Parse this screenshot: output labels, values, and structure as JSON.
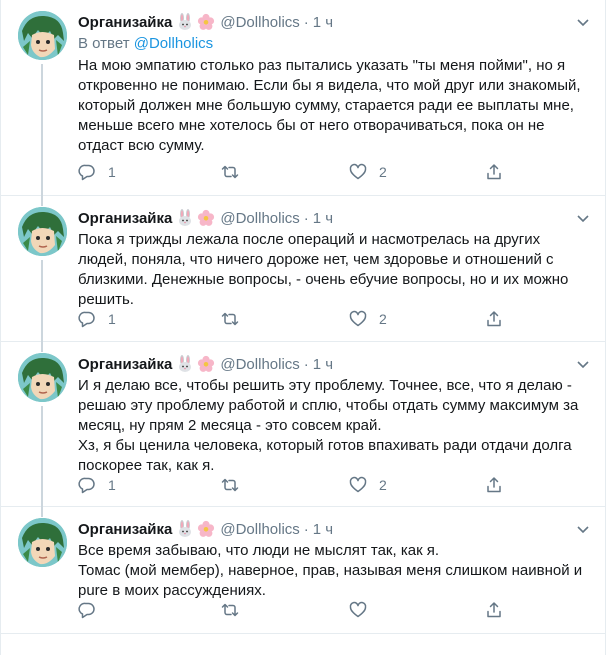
{
  "author": {
    "name": "Организайка",
    "handle": "@Dollholics",
    "time": "1 ч",
    "avatar_icon": "avatar-cartoon-icon",
    "emoji_icons": [
      "rabbit-face-icon",
      "cherry-blossom-icon"
    ]
  },
  "colors": {
    "link": "#1b95e0",
    "secondary_text": "#657786",
    "divider": "#e6ecf0",
    "thread_line": "#ccd6dd"
  },
  "tweets": [
    {
      "reply_prefix": "В ответ ",
      "reply_handle": "@Dollholics",
      "lines": [
        "На мою эмпатию столько раз пытались указать \"ты меня пойми\", но я",
        "откровенно не понимаю. Если бы я видела, что мой друг или знакомый,",
        "который должен мне большую сумму, старается ради ее выплаты мне,",
        "меньше всего мне хотелось бы от него отворачиваться, пока он не",
        "отдаст всю сумму."
      ],
      "reply_count": "1",
      "retweet_count": "",
      "like_count": "2"
    },
    {
      "lines": [
        "Пока я трижды лежала после операций и насмотрелась на других",
        "людей, поняла, что ничего дороже нет, чем здоровье и отношений с",
        "близкими. Денежные вопросы, - очень ебучие вопросы, но и их можно",
        "решить."
      ],
      "reply_count": "1",
      "retweet_count": "",
      "like_count": "2"
    },
    {
      "lines": [
        "И я делаю все, чтобы решить эту проблему. Точнее, все, что я делаю -",
        "решаю эту проблему работой и сплю, чтобы отдать сумму максимум за",
        "месяц, ну прям 2 месяца - это совсем  край.",
        "Хз,  я бы ценила человека, который готов впахивать ради отдачи долга",
        "поскорее так, как я."
      ],
      "reply_count": "1",
      "retweet_count": "",
      "like_count": "2"
    },
    {
      "lines": [
        "Все время забываю, что люди не мыслят так, как я.",
        "Томас (мой мембер), наверное, прав, называя меня слишком наивной и",
        "pure в моих рассуждениях."
      ],
      "reply_count": "",
      "retweet_count": "",
      "like_count": ""
    }
  ]
}
